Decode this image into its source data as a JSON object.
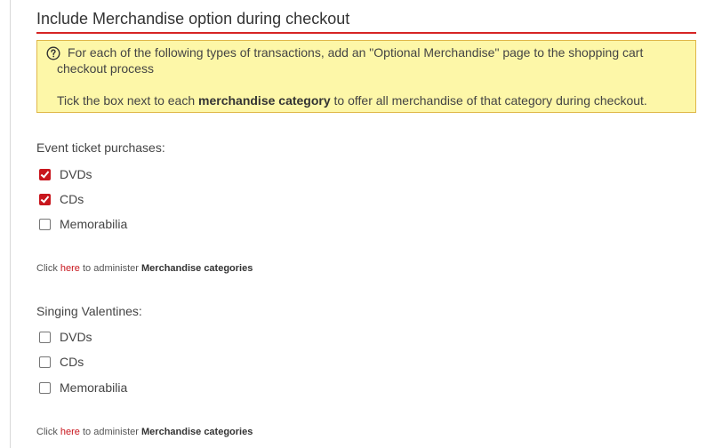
{
  "section": {
    "title": "Include Merchandise option during checkout"
  },
  "info": {
    "icon": "help-circle-icon",
    "line1": "For each of the following types of transactions, add an \"Optional Merchandise\" page to the shopping cart",
    "line2": "checkout process",
    "line3_prefix": "Tick the box next to each ",
    "line3_bold": "merchandise category",
    "line3_suffix": " to offer all merchandise of that category during checkout."
  },
  "groups": [
    {
      "label": "Event ticket purchases:",
      "options": [
        {
          "label": "DVDs",
          "checked": true
        },
        {
          "label": "CDs",
          "checked": true
        },
        {
          "label": "Memorabilia",
          "checked": false
        }
      ],
      "note": {
        "prefix": "Click ",
        "link": "here",
        "middle": " to administer ",
        "bold": "Merchandise categories"
      }
    },
    {
      "label": "Singing Valentines:",
      "options": [
        {
          "label": "DVDs",
          "checked": false
        },
        {
          "label": "CDs",
          "checked": false
        },
        {
          "label": "Memorabilia",
          "checked": false
        }
      ],
      "note": {
        "prefix": "Click ",
        "link": "here",
        "middle": " to administer ",
        "bold": "Merchandise categories"
      }
    }
  ],
  "colors": {
    "accent": "#c8161d",
    "info_bg": "#fdf7a8",
    "info_border": "#e0b84a"
  }
}
